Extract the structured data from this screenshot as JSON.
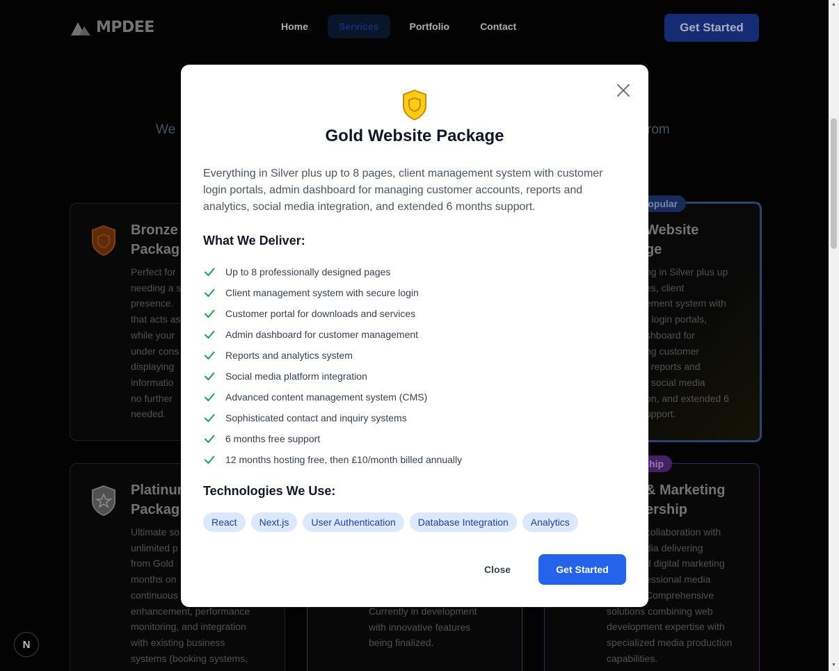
{
  "header": {
    "logo_text": "MPDEE",
    "nav": [
      "Home",
      "Services",
      "Portfolio",
      "Contact"
    ],
    "active_nav": "Services",
    "cta_label": "Get Started"
  },
  "background": {
    "subtitle_left": "We",
    "subtitle_right": "rom",
    "cards": {
      "bronze": {
        "title_lines": [
          "Bronze",
          "Packag"
        ],
        "text_lines": [
          "Perfect for",
          "needing a s",
          "presence. ",
          "that acts as",
          "while your",
          "under cons",
          "displaying",
          "informatio",
          "no further",
          "needed."
        ]
      },
      "gold": {
        "badge": "Popular",
        "title_lines": [
          "Website",
          "ge"
        ],
        "text_lines": [
          "ng in Silver plus up",
          "es, client",
          "ement system with",
          "r login portals,",
          "shboard for",
          "ng customer",
          ", reports and",
          ", social media",
          "on, and extended 6",
          "upport."
        ]
      },
      "platinum": {
        "title_lines": [
          "Platinum",
          "Packag"
        ],
        "text_lines": [
          "Ultimate so",
          "unlimited p",
          "from Gold",
          "months on",
          "continuous",
          "enhancement, performance",
          "monitoring, and integration",
          "with existing business",
          "systems (booking systems,"
        ]
      },
      "middle": {
        "text_lines": [
          "Currently in development",
          "with innovative features",
          "being finalized."
        ]
      },
      "media": {
        "badge": "ership",
        "title_lines": [
          "& Marketing",
          "ership"
        ],
        "text_lines": [
          "collaboration with",
          "dia delivering",
          "d digital marketing",
          "essional media",
          "Comprehensive",
          "solutions combining web",
          "development expertise with",
          "specialized media production",
          "capabilities."
        ]
      }
    }
  },
  "modal": {
    "title": "Gold Website Package",
    "description": "Everything in Silver plus up to 8 pages, client management system with customer login portals, admin dashboard for managing customer accounts, reports and analytics, social media integration, and extended 6 months support.",
    "deliver_heading": "What We Deliver:",
    "features": [
      "Up to 8 professionally designed pages",
      "Client management system with secure login",
      "Customer portal for downloads and services",
      "Admin dashboard for customer management",
      "Reports and analytics system",
      "Social media platform integration",
      "Advanced content management system (CMS)",
      "Sophisticated contact and inquiry systems",
      "6 months free support",
      "12 months hosting free, then £10/month billed annually"
    ],
    "tech_heading": "Technologies We Use:",
    "technologies": [
      "React",
      "Next.js",
      "User Authentication",
      "Database Integration",
      "Analytics"
    ],
    "close_label": "Close",
    "start_label": "Get Started"
  },
  "dev_badge": "N",
  "colors": {
    "accent": "#2563eb",
    "check": "#16a34a",
    "gold": "#facc15",
    "bronze": "#b45309"
  }
}
